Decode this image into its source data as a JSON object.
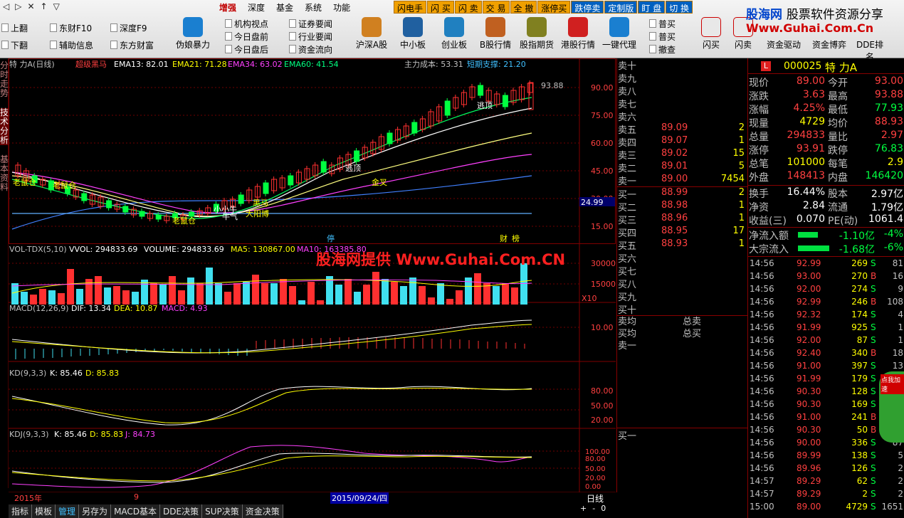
{
  "toolbar": {
    "nav": [
      "◁",
      "▷",
      "✕",
      "↑",
      "▽"
    ],
    "menu": [
      "增强",
      "深度",
      "基金",
      "系统",
      "功能"
    ],
    "trade_buttons": [
      "闪电手",
      "闪 买",
      "闪 卖",
      "交 易",
      "全 撤",
      "涨停买",
      "跌停卖",
      "定制版",
      "盯 盘",
      "切 换"
    ],
    "left_items": [
      "上翻",
      "下翻"
    ],
    "items2": [
      "东财F10",
      "辅助信息"
    ],
    "items3": [
      "深度F9",
      "东方财富"
    ],
    "btn_fake": "伪娘暴力",
    "items4": [
      "机构视点",
      "今日盘前",
      "今日盘后"
    ],
    "items5": [
      "证券要闻",
      "行业要闻",
      "资金流向"
    ],
    "big_buttons": [
      "沪深A股",
      "中小板",
      "创业板",
      "B股行情",
      "股指期货",
      "港股行情",
      "一键代理"
    ],
    "side3": [
      "普买",
      "普买",
      "撤查"
    ],
    "right_btns": [
      "闪买",
      "闪卖",
      "资金驱动",
      "资金博弈",
      "DDE排名"
    ]
  },
  "logo": {
    "name1": "股海网",
    "name2": "股票软件资源分享",
    "url": "Www.Guhai.Com.Cn"
  },
  "lefttabs": [
    "分时走势",
    "技术分析",
    "基本资料"
  ],
  "chart": {
    "title": "特 力A(日线)",
    "indicator_name": "超级黑马",
    "ema13": "EMA13: 82.01",
    "ema21": "EMA21: 71.28",
    "ema34": "EMA34: 63.02",
    "ema60": "EMA60: 41.54",
    "main_cost": "主力成本: 53.31",
    "support": "短期支撑: 21.20",
    "high_label": "93.88",
    "price_axis": [
      "90.00",
      "75.00",
      "60.00",
      "45.00",
      "30.00",
      "15.00"
    ],
    "cost_tag": "24.99",
    "annotations": [
      "老鼠仓",
      "老鼠仓",
      "老鼠仓",
      "逃顶",
      "逃顶",
      "黑马",
      "大阳博",
      "小小牛",
      "牛气",
      "金叉",
      "逃顶"
    ],
    "chart_flags": [
      "停",
      "财",
      "榜"
    ],
    "vol_title": "VOL-TDX(5,10)",
    "vvol": "VVOL: 294833.69",
    "volume": "VOLUME: 294833.69",
    "ma5": "MA5: 130867.00",
    "ma10": "MA10: 163385.80",
    "vol_axis": [
      "30000",
      "15000",
      "X10"
    ],
    "watermark": "股海网提供 Www.Guhai.Com.CN",
    "macd_title": "MACD(12,26,9)",
    "dif": "DIF: 13.34",
    "dea": "DEA: 10.87",
    "macd": "MACD: 4.93",
    "macd_axis": [
      "10.00"
    ],
    "kd_title": "KD(9,3,3)",
    "kd_k": "K: 85.46",
    "kd_d": "D: 85.83",
    "kd_axis": [
      "80.00",
      "50.00",
      "20.00"
    ],
    "kdj_title": "KDJ(9,3,3)",
    "kdj_k": "K: 85.46",
    "kdj_d": "D: 85.83",
    "kdj_j": "J: 84.73",
    "kdj_axis": [
      "100.00",
      "80.00",
      "50.00",
      "20.00",
      "0.00"
    ],
    "date_left": "2015年",
    "date_mid": "9",
    "date_cursor": "2015/09/24/四",
    "period": "日线"
  },
  "book": {
    "sell": [
      {
        "label": "卖十",
        "price": "",
        "vol": ""
      },
      {
        "label": "卖九",
        "price": "",
        "vol": ""
      },
      {
        "label": "卖八",
        "price": "",
        "vol": ""
      },
      {
        "label": "卖七",
        "price": "",
        "vol": ""
      },
      {
        "label": "卖六",
        "price": "",
        "vol": ""
      },
      {
        "label": "卖五",
        "price": "89.09",
        "vol": "2"
      },
      {
        "label": "卖四",
        "price": "89.07",
        "vol": "1"
      },
      {
        "label": "卖三",
        "price": "89.02",
        "vol": "15"
      },
      {
        "label": "卖二",
        "price": "89.01",
        "vol": "5"
      },
      {
        "label": "卖一",
        "price": "89.00",
        "vol": "7454"
      }
    ],
    "buy": [
      {
        "label": "买一",
        "price": "88.99",
        "vol": "2"
      },
      {
        "label": "买二",
        "price": "88.98",
        "vol": "1"
      },
      {
        "label": "买三",
        "price": "88.96",
        "vol": "1"
      },
      {
        "label": "买四",
        "price": "88.95",
        "vol": "17"
      },
      {
        "label": "买五",
        "price": "88.93",
        "vol": "1"
      },
      {
        "label": "买六",
        "price": "",
        "vol": ""
      },
      {
        "label": "买七",
        "price": "",
        "vol": ""
      },
      {
        "label": "买八",
        "price": "",
        "vol": ""
      },
      {
        "label": "买九",
        "price": "",
        "vol": ""
      },
      {
        "label": "买十",
        "price": "",
        "vol": ""
      }
    ],
    "avg_sell_label": "卖均",
    "avg_buy_label": "买均",
    "total_sell": "总卖",
    "total_buy": "总买",
    "sell1_2": "卖一",
    "buy1_2": "买一"
  },
  "quote": {
    "code": "000025",
    "name": "特 力A",
    "badge": "L",
    "rows": [
      [
        "现价",
        "89.00",
        "今开",
        "93.00"
      ],
      [
        "涨跌",
        "3.63",
        "最高",
        "93.88"
      ],
      [
        "涨幅",
        "4.25%",
        "最低",
        "77.93"
      ],
      [
        "现量",
        "4729",
        "均价",
        "88.93"
      ],
      [
        "总量",
        "294833",
        "量比",
        "2.97"
      ],
      [
        "涨停",
        "93.91",
        "跌停",
        "76.83"
      ],
      [
        "总笔",
        "101000",
        "每笔",
        "2.9"
      ],
      [
        "外盘",
        "148413",
        "内盘",
        "146420"
      ]
    ],
    "rows2": [
      [
        "换手",
        "16.44%",
        "股本",
        "2.97亿"
      ],
      [
        "净资",
        "2.84",
        "流通",
        "1.79亿"
      ],
      [
        "收益(三)",
        "0.070",
        "PE(动)",
        "1061.4"
      ]
    ],
    "flow": [
      [
        "净流入额",
        "-1.10亿",
        "-4%"
      ],
      [
        "大宗流入",
        "-1.68亿",
        "-6%"
      ]
    ],
    "ticks": [
      [
        "14:56",
        "92.99",
        "269",
        "S",
        "81"
      ],
      [
        "14:56",
        "93.00",
        "270",
        "B",
        "16"
      ],
      [
        "14:56",
        "92.00",
        "274",
        "S",
        "9"
      ],
      [
        "14:56",
        "92.99",
        "246",
        "B",
        "108"
      ],
      [
        "14:56",
        "92.32",
        "174",
        "S",
        "4"
      ],
      [
        "14:56",
        "91.99",
        "925",
        "S",
        "1"
      ],
      [
        "14:56",
        "92.00",
        "87",
        "S",
        "1"
      ],
      [
        "14:56",
        "92.40",
        "340",
        "B",
        "18"
      ],
      [
        "14:56",
        "91.00",
        "397",
        "S",
        "13"
      ],
      [
        "14:56",
        "91.99",
        "179",
        "S",
        "2"
      ],
      [
        "14:56",
        "90.30",
        "128",
        "S",
        "3"
      ],
      [
        "14:56",
        "90.30",
        "169",
        "S",
        "2"
      ],
      [
        "14:56",
        "91.00",
        "241",
        "B",
        "3"
      ],
      [
        "14:56",
        "90.30",
        "50",
        "B",
        "9"
      ],
      [
        "14:56",
        "90.00",
        "336",
        "S",
        "87"
      ],
      [
        "14:56",
        "89.99",
        "138",
        "S",
        "5"
      ],
      [
        "14:56",
        "89.96",
        "126",
        "S",
        "2"
      ],
      [
        "14:57",
        "89.29",
        "62",
        "S",
        "2"
      ],
      [
        "14:57",
        "89.29",
        "2",
        "S",
        "2"
      ],
      [
        "15:00",
        "89.00",
        "4729",
        "S",
        "1651"
      ]
    ],
    "ad_text": "点我加速"
  },
  "bottom_tabs": [
    "指标",
    "模板",
    "管理",
    "另存为",
    "MACD基本",
    "DDE决策",
    "SUP决策",
    "资金决策"
  ],
  "bottom_right": [
    "+",
    "-",
    "0"
  ]
}
